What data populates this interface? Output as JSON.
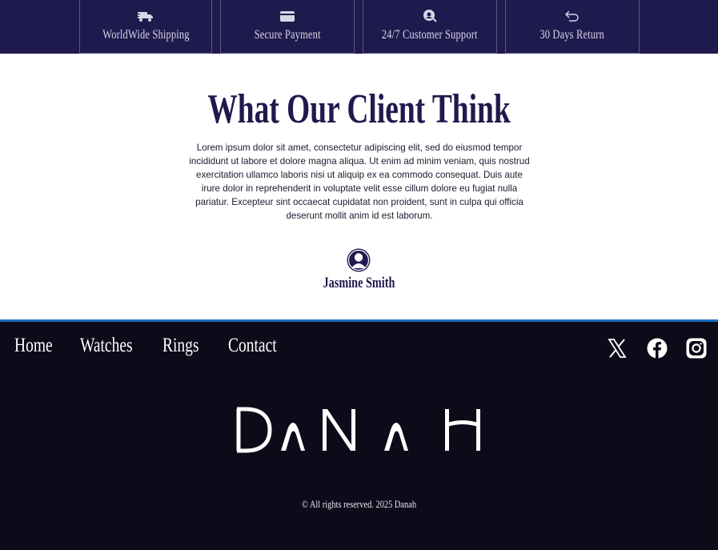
{
  "features": [
    {
      "icon": "truck-icon",
      "label": "WorldWide Shipping"
    },
    {
      "icon": "credit-card-icon",
      "label": "Secure Payment"
    },
    {
      "icon": "support-headset-icon",
      "label": "24/7 Customer Support"
    },
    {
      "icon": "return-arrow-icon",
      "label": "30 Days Return"
    }
  ],
  "testimonial": {
    "title": "What Our Client Think",
    "body": "Lorem ipsum dolor sit amet, consectetur adipiscing elit, sed do eiusmod tempor incididunt ut labore et dolore magna aliqua. Ut enim ad minim veniam, quis nostrud exercitation ullamco laboris nisi ut aliquip ex ea commodo consequat. Duis aute irure dolor in reprehenderit in voluptate velit esse cillum dolore eu fugiat nulla pariatur. Excepteur sint occaecat cupidatat non proident, sunt in culpa qui officia deserunt mollit anim id est laborum.",
    "avatar_icon": "user-avatar-icon",
    "name": "Jasmine Smith"
  },
  "footer": {
    "nav": [
      {
        "label": "Home"
      },
      {
        "label": "Watches"
      },
      {
        "label": "Rings"
      },
      {
        "label": "Contact"
      }
    ],
    "social": [
      "x-twitter-icon",
      "facebook-icon",
      "instagram-icon"
    ],
    "logo_text": "DANAH",
    "copyright": "© All rights reserved. 2025 Danah"
  },
  "colors": {
    "navy": "#1f1a4e",
    "footer_bg": "#0d0b19",
    "footer_accent": "#1d6fc2"
  }
}
